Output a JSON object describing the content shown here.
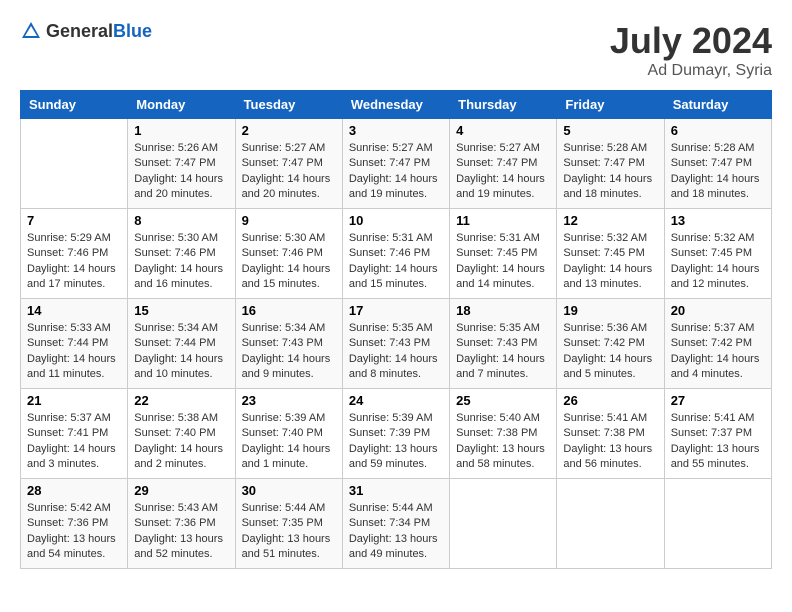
{
  "header": {
    "logo_general": "General",
    "logo_blue": "Blue",
    "title": "July 2024",
    "location": "Ad Dumayr, Syria"
  },
  "weekdays": [
    "Sunday",
    "Monday",
    "Tuesday",
    "Wednesday",
    "Thursday",
    "Friday",
    "Saturday"
  ],
  "weeks": [
    [
      {
        "day": "",
        "info": ""
      },
      {
        "day": "1",
        "info": "Sunrise: 5:26 AM\nSunset: 7:47 PM\nDaylight: 14 hours\nand 20 minutes."
      },
      {
        "day": "2",
        "info": "Sunrise: 5:27 AM\nSunset: 7:47 PM\nDaylight: 14 hours\nand 20 minutes."
      },
      {
        "day": "3",
        "info": "Sunrise: 5:27 AM\nSunset: 7:47 PM\nDaylight: 14 hours\nand 19 minutes."
      },
      {
        "day": "4",
        "info": "Sunrise: 5:27 AM\nSunset: 7:47 PM\nDaylight: 14 hours\nand 19 minutes."
      },
      {
        "day": "5",
        "info": "Sunrise: 5:28 AM\nSunset: 7:47 PM\nDaylight: 14 hours\nand 18 minutes."
      },
      {
        "day": "6",
        "info": "Sunrise: 5:28 AM\nSunset: 7:47 PM\nDaylight: 14 hours\nand 18 minutes."
      }
    ],
    [
      {
        "day": "7",
        "info": "Sunrise: 5:29 AM\nSunset: 7:46 PM\nDaylight: 14 hours\nand 17 minutes."
      },
      {
        "day": "8",
        "info": "Sunrise: 5:30 AM\nSunset: 7:46 PM\nDaylight: 14 hours\nand 16 minutes."
      },
      {
        "day": "9",
        "info": "Sunrise: 5:30 AM\nSunset: 7:46 PM\nDaylight: 14 hours\nand 15 minutes."
      },
      {
        "day": "10",
        "info": "Sunrise: 5:31 AM\nSunset: 7:46 PM\nDaylight: 14 hours\nand 15 minutes."
      },
      {
        "day": "11",
        "info": "Sunrise: 5:31 AM\nSunset: 7:45 PM\nDaylight: 14 hours\nand 14 minutes."
      },
      {
        "day": "12",
        "info": "Sunrise: 5:32 AM\nSunset: 7:45 PM\nDaylight: 14 hours\nand 13 minutes."
      },
      {
        "day": "13",
        "info": "Sunrise: 5:32 AM\nSunset: 7:45 PM\nDaylight: 14 hours\nand 12 minutes."
      }
    ],
    [
      {
        "day": "14",
        "info": "Sunrise: 5:33 AM\nSunset: 7:44 PM\nDaylight: 14 hours\nand 11 minutes."
      },
      {
        "day": "15",
        "info": "Sunrise: 5:34 AM\nSunset: 7:44 PM\nDaylight: 14 hours\nand 10 minutes."
      },
      {
        "day": "16",
        "info": "Sunrise: 5:34 AM\nSunset: 7:43 PM\nDaylight: 14 hours\nand 9 minutes."
      },
      {
        "day": "17",
        "info": "Sunrise: 5:35 AM\nSunset: 7:43 PM\nDaylight: 14 hours\nand 8 minutes."
      },
      {
        "day": "18",
        "info": "Sunrise: 5:35 AM\nSunset: 7:43 PM\nDaylight: 14 hours\nand 7 minutes."
      },
      {
        "day": "19",
        "info": "Sunrise: 5:36 AM\nSunset: 7:42 PM\nDaylight: 14 hours\nand 5 minutes."
      },
      {
        "day": "20",
        "info": "Sunrise: 5:37 AM\nSunset: 7:42 PM\nDaylight: 14 hours\nand 4 minutes."
      }
    ],
    [
      {
        "day": "21",
        "info": "Sunrise: 5:37 AM\nSunset: 7:41 PM\nDaylight: 14 hours\nand 3 minutes."
      },
      {
        "day": "22",
        "info": "Sunrise: 5:38 AM\nSunset: 7:40 PM\nDaylight: 14 hours\nand 2 minutes."
      },
      {
        "day": "23",
        "info": "Sunrise: 5:39 AM\nSunset: 7:40 PM\nDaylight: 14 hours\nand 1 minute."
      },
      {
        "day": "24",
        "info": "Sunrise: 5:39 AM\nSunset: 7:39 PM\nDaylight: 13 hours\nand 59 minutes."
      },
      {
        "day": "25",
        "info": "Sunrise: 5:40 AM\nSunset: 7:38 PM\nDaylight: 13 hours\nand 58 minutes."
      },
      {
        "day": "26",
        "info": "Sunrise: 5:41 AM\nSunset: 7:38 PM\nDaylight: 13 hours\nand 56 minutes."
      },
      {
        "day": "27",
        "info": "Sunrise: 5:41 AM\nSunset: 7:37 PM\nDaylight: 13 hours\nand 55 minutes."
      }
    ],
    [
      {
        "day": "28",
        "info": "Sunrise: 5:42 AM\nSunset: 7:36 PM\nDaylight: 13 hours\nand 54 minutes."
      },
      {
        "day": "29",
        "info": "Sunrise: 5:43 AM\nSunset: 7:36 PM\nDaylight: 13 hours\nand 52 minutes."
      },
      {
        "day": "30",
        "info": "Sunrise: 5:44 AM\nSunset: 7:35 PM\nDaylight: 13 hours\nand 51 minutes."
      },
      {
        "day": "31",
        "info": "Sunrise: 5:44 AM\nSunset: 7:34 PM\nDaylight: 13 hours\nand 49 minutes."
      },
      {
        "day": "",
        "info": ""
      },
      {
        "day": "",
        "info": ""
      },
      {
        "day": "",
        "info": ""
      }
    ]
  ]
}
